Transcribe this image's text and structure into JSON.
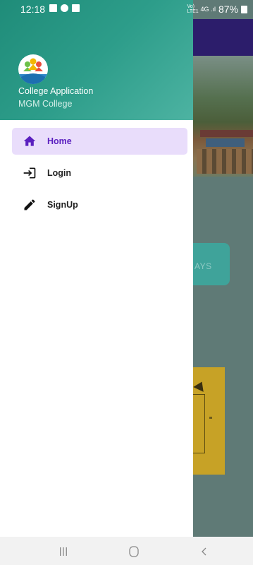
{
  "status_bar": {
    "time": "12:18",
    "volte": "Vo) 4G\nLTE1",
    "battery": "87%"
  },
  "background": {
    "card_text": "AYS"
  },
  "drawer": {
    "header": {
      "title": "College Application",
      "subtitle": "MGM College"
    },
    "menu": [
      {
        "label": "Home",
        "icon": "home-icon",
        "active": true
      },
      {
        "label": "Login",
        "icon": "login-icon",
        "active": false
      },
      {
        "label": "SignUp",
        "icon": "pencil-icon",
        "active": false
      }
    ]
  },
  "colors": {
    "header_teal": "#2d9d8a",
    "active_bg": "#e9ddfb",
    "active_text": "#5a1fbf"
  },
  "nav_bar": {
    "recent": "recent-apps-icon",
    "home": "home-button-icon",
    "back": "back-icon"
  }
}
